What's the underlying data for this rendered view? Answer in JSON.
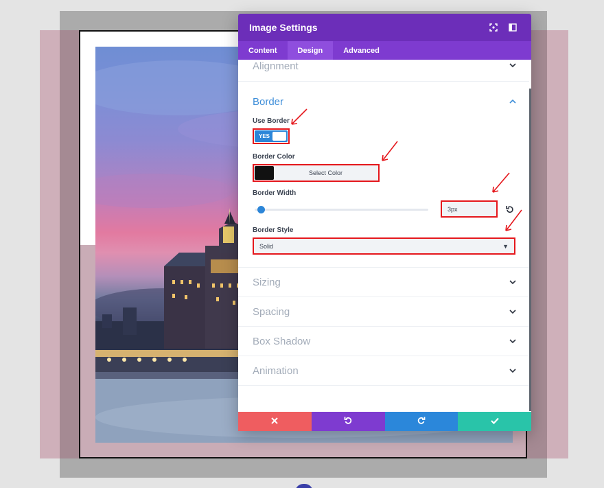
{
  "modal": {
    "title": "Image Settings",
    "tabs": [
      {
        "label": "Content",
        "active": false
      },
      {
        "label": "Design",
        "active": true
      },
      {
        "label": "Advanced",
        "active": false
      }
    ]
  },
  "sections": {
    "alignment": "Alignment",
    "border": "Border",
    "collapsed": [
      "Sizing",
      "Spacing",
      "Box Shadow",
      "Animation"
    ]
  },
  "border": {
    "use_border_label": "Use Border",
    "toggle_text": "YES",
    "toggle_on": true,
    "border_color_label": "Border Color",
    "swatch_color": "#111111",
    "select_color_label": "Select Color",
    "border_width_label": "Border Width",
    "border_width_value": "3px",
    "border_style_label": "Border Style",
    "border_style_value": "Solid"
  },
  "colors": {
    "header": "#6c2eb9",
    "tabs": "#7e3bd0",
    "accent_blue": "#2c86d8",
    "highlight_red": "#e5171c",
    "footer_close": "#ef5d60",
    "footer_undo": "#7e3bd0",
    "footer_redo": "#2b87da",
    "footer_save": "#29c4a9"
  },
  "icons": {
    "header": [
      "fullscreen-icon",
      "sidebar-toggle-icon"
    ],
    "footer": [
      "close-icon",
      "undo-icon",
      "redo-icon",
      "check-icon"
    ]
  }
}
